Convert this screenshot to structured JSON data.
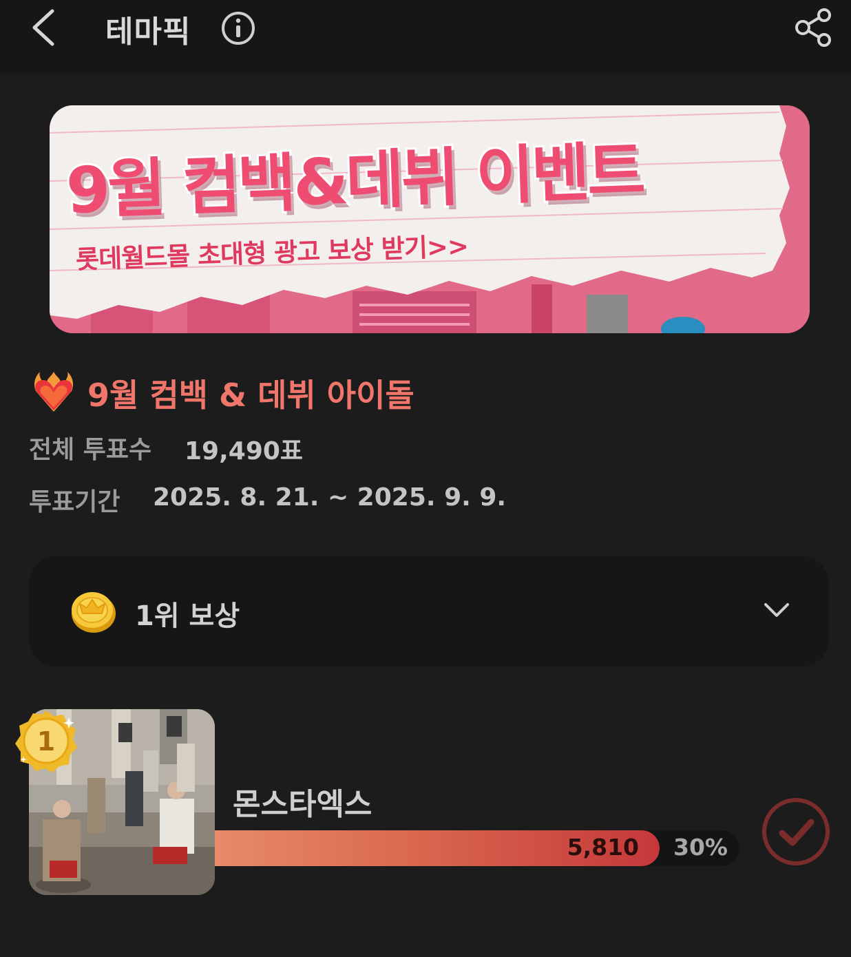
{
  "header": {
    "title": "테마픽",
    "back_icon": "chevron-left-icon",
    "info_icon": "info-icon",
    "share_icon": "share-icon"
  },
  "banner": {
    "title": "9월 컴백&데뷔 이벤트",
    "subtitle": "롯데월드몰 초대형 광고 보상 받기>>",
    "colors": {
      "bg": "#e46b8a",
      "title": "#ee4d71"
    }
  },
  "topic": {
    "emoji_icon": "heart-on-fire-icon",
    "title": "9월 컴백 & 데뷔 아이돌",
    "total_votes_label": "전체 투표수",
    "total_votes_value": "19,490표",
    "period_label": "투표기간",
    "period_value": "2025. 8. 21. ~ 2025. 9. 9."
  },
  "reward": {
    "icon": "coin-crown-icon",
    "label": "1위 보상"
  },
  "ranking": [
    {
      "rank": "1",
      "name": "몬스타엑스",
      "votes": "5,810",
      "percent": "30%",
      "share": 0.3
    }
  ],
  "colors": {
    "background": "#1c1c1c",
    "accent": "#f0766c",
    "bar_start": "#e88a6b",
    "bar_end": "#c5383a",
    "vote_button": "#7a2b2b"
  }
}
